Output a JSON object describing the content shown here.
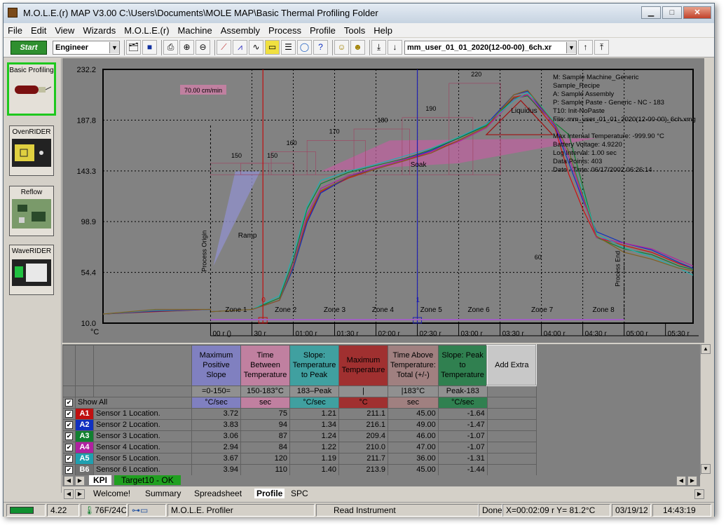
{
  "window": {
    "title": "M.O.L.E.(r) MAP V3.00    C:\\Users\\Documents\\MOLE MAP\\Basic Thermal Profiling Folder",
    "min_label": "▁",
    "max_label": "□",
    "close_label": "✕"
  },
  "menu": [
    "File",
    "Edit",
    "View",
    "Wizards",
    "M.O.L.E.(r)",
    "Machine",
    "Assembly",
    "Process",
    "Profile",
    "Tools",
    "Help"
  ],
  "toolbar": {
    "start_label": "Start",
    "user_level": "Engineer",
    "file_name": "mm_user_01_01_2020(12-00-00)_6ch.xr",
    "icons": [
      "tree-icon",
      "save-icon",
      "print-icon",
      "zoom-in-icon",
      "zoom-out-icon",
      "edit-chart-icon",
      "edit-axis-icon",
      "edit-lines-icon",
      "ruler-icon",
      "list-icon",
      "globe-icon",
      "help-icon",
      "user-a-icon",
      "user-b-icon",
      "first-icon",
      "down-icon",
      "up-icon",
      "last-icon"
    ]
  },
  "left_panel": [
    {
      "label": "Basic Profiling",
      "active": true
    },
    {
      "label": "OvenRIDER",
      "active": false
    },
    {
      "label": "Reflow",
      "active": false
    },
    {
      "label": "WaveRIDER",
      "active": false
    }
  ],
  "chart_data": {
    "type": "line",
    "ylabel": "°C",
    "ylim": [
      10.0,
      232.2
    ],
    "yticks": [
      "232.2",
      "187.8",
      "143.3",
      "98.9",
      "54.4",
      "10.0"
    ],
    "xlim_sec": [
      0,
      350
    ],
    "xticks": [
      "00 r ()",
      "30 r",
      "01:00 r",
      "01:30 r",
      "02:00 r",
      "02:30 r",
      "03:00 r",
      "03:30 r",
      "04:00 r",
      "04:30 r",
      "05:00 r",
      "05:30 r"
    ],
    "slope_label": "70.00 cm/min",
    "zones": [
      "Zone 1",
      "Zone 2",
      "Zone 3",
      "Zone 4",
      "Zone 5",
      "Zone 6",
      "Zone 7",
      "Zone 8"
    ],
    "annotations": {
      "process_origin": "Process Origin",
      "process_end": "Process End",
      "ramp": "Ramp",
      "soak": "Soak",
      "liquidus": "Liquidus",
      "marker_0": "0",
      "marker_1": "1"
    },
    "temp_labels": [
      "150",
      "150",
      "160",
      "170",
      "180",
      "190",
      "220",
      "60"
    ],
    "info": [
      "M: Sample Machine_Generic",
      "      Sample_Recipe",
      "A: Sample Assembly",
      "P: Sample Paste - Generic - NC - 183",
      "T10: Init-NoPaste",
      "File: mm_user_01_01_2020(12-00-00)_6ch.xmg",
      "",
      "Max Internal Temperature: -999.90 °C",
      "Battery Voltage: 4.9220",
      "Log Interval: 1.00 sec",
      "Data Points: 403",
      "Date - Time: 06/17/2002 06:26:14"
    ],
    "series": [
      {
        "name": "A1",
        "color": "#d01010",
        "x": [
          0,
          30,
          50,
          60,
          70,
          80,
          100,
          120,
          140,
          160,
          180,
          200,
          220,
          230,
          240,
          250,
          260,
          270,
          280,
          300,
          320,
          340,
          350
        ],
        "y": [
          20,
          22,
          30,
          60,
          100,
          125,
          137,
          145,
          152,
          160,
          170,
          182,
          208,
          210,
          195,
          180,
          140,
          110,
          85,
          78,
          72,
          62,
          58
        ]
      },
      {
        "name": "A2",
        "color": "#1030c0",
        "x": [
          0,
          30,
          50,
          60,
          70,
          80,
          100,
          120,
          140,
          160,
          180,
          200,
          220,
          230,
          240,
          250,
          260,
          270,
          280,
          300,
          320,
          340,
          350
        ],
        "y": [
          20,
          22,
          30,
          58,
          98,
          124,
          138,
          146,
          153,
          161,
          172,
          184,
          210,
          213,
          198,
          182,
          150,
          118,
          90,
          80,
          74,
          63,
          58
        ]
      },
      {
        "name": "A3",
        "color": "#108030",
        "x": [
          0,
          30,
          50,
          60,
          70,
          80,
          100,
          120,
          140,
          160,
          180,
          200,
          220,
          230,
          240,
          250,
          260,
          270,
          280,
          300,
          320,
          340,
          350
        ],
        "y": [
          20,
          22,
          32,
          65,
          110,
          132,
          142,
          148,
          154,
          162,
          172,
          183,
          207,
          209,
          196,
          185,
          175,
          130,
          85,
          75,
          70,
          60,
          57
        ]
      },
      {
        "name": "A4",
        "color": "#b020a0",
        "x": [
          0,
          30,
          50,
          60,
          70,
          80,
          100,
          120,
          140,
          160,
          180,
          200,
          220,
          230,
          240,
          250,
          260,
          270,
          280,
          300,
          320,
          340,
          350
        ],
        "y": [
          20,
          22,
          30,
          62,
          105,
          128,
          139,
          146,
          153,
          160,
          169,
          181,
          206,
          210,
          197,
          183,
          155,
          120,
          85,
          80,
          75,
          65,
          60
        ]
      },
      {
        "name": "A5",
        "color": "#20b0b0",
        "x": [
          0,
          30,
          50,
          60,
          70,
          80,
          100,
          120,
          140,
          160,
          180,
          200,
          220,
          230,
          240,
          250,
          260,
          270,
          280,
          300,
          320,
          340,
          350
        ],
        "y": [
          20,
          22,
          34,
          70,
          112,
          135,
          143,
          149,
          156,
          163,
          173,
          184,
          205,
          212,
          200,
          185,
          160,
          125,
          88,
          76,
          68,
          58,
          52
        ]
      },
      {
        "name": "B6",
        "color": "#806020",
        "x": [
          0,
          30,
          50,
          60,
          70,
          80,
          100,
          120,
          140,
          160,
          180,
          200,
          220,
          230,
          240,
          250,
          260,
          270,
          280,
          300,
          320,
          340,
          350
        ],
        "y": [
          20,
          22,
          30,
          60,
          102,
          126,
          138,
          145,
          152,
          159,
          170,
          182,
          210,
          214,
          199,
          184,
          160,
          122,
          86,
          72,
          66,
          58,
          56
        ]
      }
    ]
  },
  "grid": {
    "columns": [
      {
        "title": "Maximum Positive Slope",
        "range": "=0-150=",
        "unit": "°C/sec",
        "bg": "#8080c0",
        "unit_bg": "#8080c0"
      },
      {
        "title": "Time Between Temperature",
        "range": "150-183°C",
        "unit": "sec",
        "bg": "#c080a0",
        "unit_bg": "#c080a0"
      },
      {
        "title": "Slope: Temperature to Peak",
        "range": "183–Peak",
        "unit": "°C/sec",
        "bg": "#40a0a0",
        "unit_bg": "#40a0a0"
      },
      {
        "title": "Maximum Temperature",
        "range": "|",
        "unit": "°C",
        "bg": "#a03030",
        "unit_bg": "#a03030"
      },
      {
        "title": "Time Above Temperature: Total (+/-)",
        "range": "|183°C",
        "unit": "sec",
        "bg": "#a08080",
        "unit_bg": "#a08080"
      },
      {
        "title": "Slope: Peak to Temperature",
        "range": "Peak-183",
        "unit": "°C/sec",
        "bg": "#308050",
        "unit_bg": "#308050"
      }
    ],
    "add_extra": "Add Extra",
    "show_all": "Show All",
    "rows": [
      {
        "id": "A1",
        "color": "#c01010",
        "name": "Sensor 1 Location.",
        "vals": [
          "3.72",
          "75",
          "1.21",
          "211.1",
          "45.00",
          "-1.64"
        ]
      },
      {
        "id": "A2",
        "color": "#1030c0",
        "name": "Sensor 2 Location.",
        "vals": [
          "3.83",
          "94",
          "1.34",
          "216.1",
          "49.00",
          "-1.47"
        ]
      },
      {
        "id": "A3",
        "color": "#108030",
        "name": "Sensor 3 Location.",
        "vals": [
          "3.06",
          "87",
          "1.24",
          "209.4",
          "46.00",
          "-1.07"
        ]
      },
      {
        "id": "A4",
        "color": "#b020a0",
        "name": "Sensor 4 Location.",
        "vals": [
          "2.94",
          "84",
          "1.22",
          "210.0",
          "47.00",
          "-1.07"
        ]
      },
      {
        "id": "A5",
        "color": "#20a0b0",
        "name": "Sensor 5 Location.",
        "vals": [
          "3.67",
          "120",
          "1.19",
          "211.7",
          "36.00",
          "-1.31"
        ]
      },
      {
        "id": "B6",
        "color": "#707070",
        "name": "Sensor 6 Location.",
        "vals": [
          "3.94",
          "110",
          "1.40",
          "213.9",
          "45.00",
          "-1.44"
        ]
      }
    ]
  },
  "kpi_tabs": [
    "KPI",
    "Target10 - OK"
  ],
  "page_tabs": [
    "Welcome!",
    "Summary",
    "Spreadsheet",
    "Profile",
    "SPC"
  ],
  "status": {
    "battery": "4.22",
    "temp": "76F/24C",
    "profiler": "M.O.L.E. Profiler",
    "action": "Read Instrument",
    "state": "Done",
    "coords": "X=00:02:09 r Y=  81.2°C",
    "date": "03/19/12",
    "time": "14:43:19"
  }
}
